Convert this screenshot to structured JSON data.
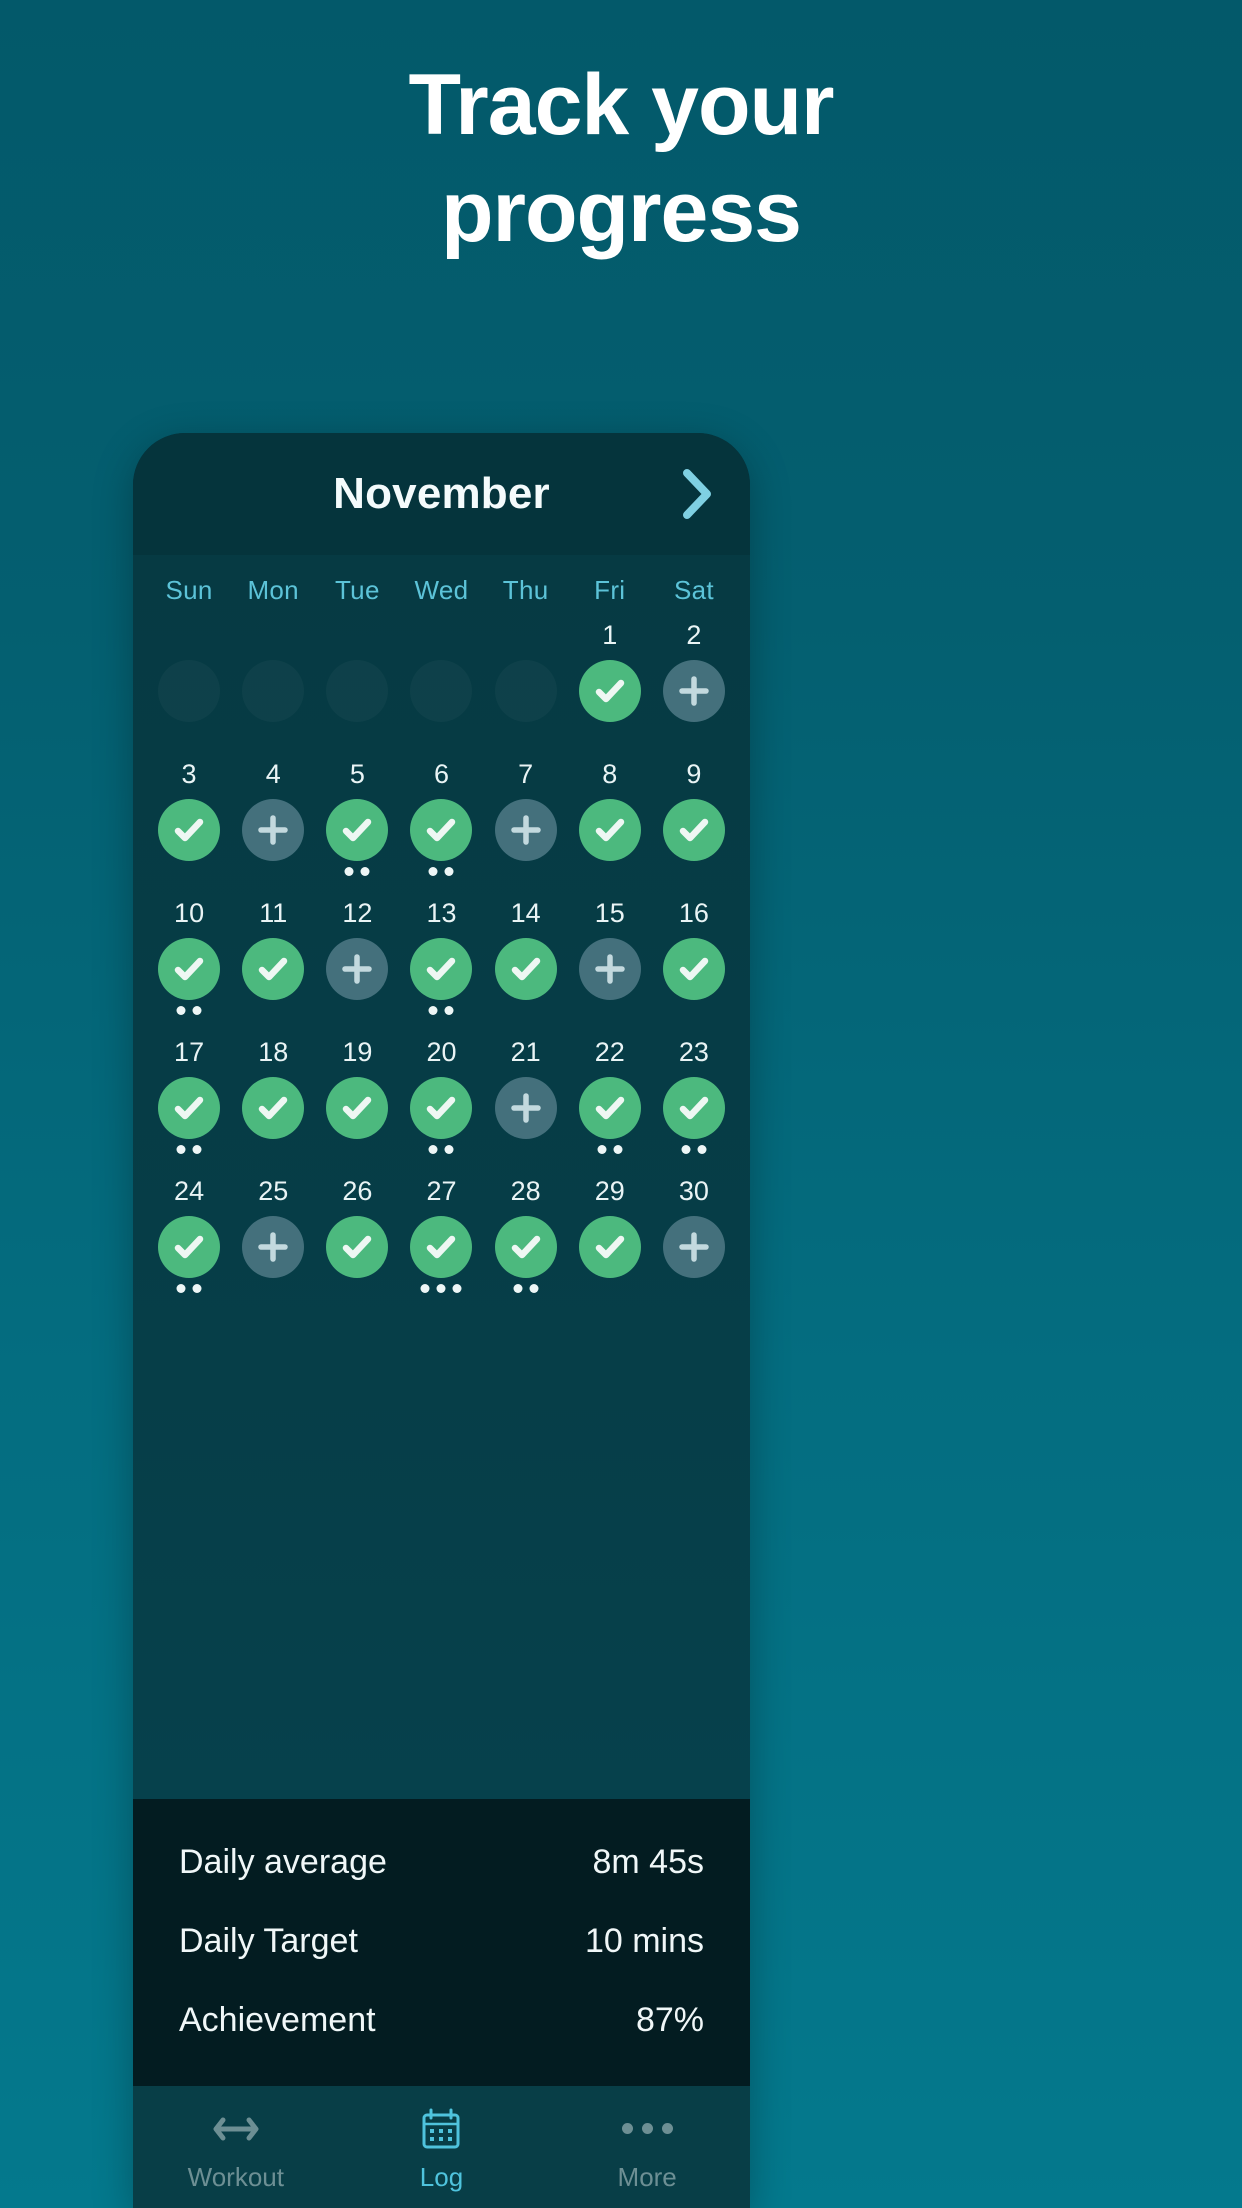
{
  "headline": {
    "line1": "Track your",
    "line2": "progress"
  },
  "colors": {
    "background": "#046070",
    "card": "#04343c",
    "calendar": "#063a43",
    "stats_panel": "#031c21",
    "tabbar": "#083e47",
    "accent_green": "#4cb97e",
    "accent_cyan": "#5cc3d8",
    "plus_bubble": "#44707c"
  },
  "app": {
    "header": {
      "month": "November",
      "next_icon": "chevron-right-icon"
    },
    "calendar": {
      "weekdays": [
        "Sun",
        "Mon",
        "Tue",
        "Wed",
        "Thu",
        "Fri",
        "Sat"
      ],
      "weeks": [
        [
          {
            "num": "",
            "state": "empty"
          },
          {
            "num": "",
            "state": "empty"
          },
          {
            "num": "",
            "state": "empty"
          },
          {
            "num": "",
            "state": "empty"
          },
          {
            "num": "",
            "state": "empty"
          },
          {
            "num": "1",
            "state": "done",
            "dots": 0
          },
          {
            "num": "2",
            "state": "plus",
            "dots": 0
          }
        ],
        [
          {
            "num": "3",
            "state": "done",
            "dots": 0
          },
          {
            "num": "4",
            "state": "plus",
            "dots": 0
          },
          {
            "num": "5",
            "state": "done",
            "dots": 2
          },
          {
            "num": "6",
            "state": "done",
            "dots": 2
          },
          {
            "num": "7",
            "state": "plus",
            "dots": 0
          },
          {
            "num": "8",
            "state": "done",
            "dots": 0
          },
          {
            "num": "9",
            "state": "done",
            "dots": 0
          }
        ],
        [
          {
            "num": "10",
            "state": "done",
            "dots": 2
          },
          {
            "num": "11",
            "state": "done",
            "dots": 0
          },
          {
            "num": "12",
            "state": "plus",
            "dots": 0
          },
          {
            "num": "13",
            "state": "done",
            "dots": 2
          },
          {
            "num": "14",
            "state": "done",
            "dots": 0
          },
          {
            "num": "15",
            "state": "plus",
            "dots": 0
          },
          {
            "num": "16",
            "state": "done",
            "dots": 0
          }
        ],
        [
          {
            "num": "17",
            "state": "done",
            "dots": 2
          },
          {
            "num": "18",
            "state": "done",
            "dots": 0
          },
          {
            "num": "19",
            "state": "done",
            "dots": 0
          },
          {
            "num": "20",
            "state": "done",
            "dots": 2
          },
          {
            "num": "21",
            "state": "plus",
            "dots": 0
          },
          {
            "num": "22",
            "state": "done",
            "dots": 2
          },
          {
            "num": "23",
            "state": "done",
            "dots": 2
          }
        ],
        [
          {
            "num": "24",
            "state": "done",
            "dots": 2
          },
          {
            "num": "25",
            "state": "plus",
            "dots": 0
          },
          {
            "num": "26",
            "state": "done",
            "dots": 0
          },
          {
            "num": "27",
            "state": "done",
            "dots": 3
          },
          {
            "num": "28",
            "state": "done",
            "dots": 2
          },
          {
            "num": "29",
            "state": "done",
            "dots": 0
          },
          {
            "num": "30",
            "state": "plus",
            "dots": 0
          }
        ]
      ]
    },
    "stats": [
      {
        "label": "Daily average",
        "value": "8m 45s"
      },
      {
        "label": "Daily Target",
        "value": "10 mins"
      },
      {
        "label": "Achievement",
        "value": "87%"
      }
    ],
    "tabs": [
      {
        "label": "Workout",
        "icon": "dumbbell-icon",
        "active": false
      },
      {
        "label": "Log",
        "icon": "calendar-icon",
        "active": true
      },
      {
        "label": "More",
        "icon": "ellipsis-icon",
        "active": false
      }
    ]
  }
}
